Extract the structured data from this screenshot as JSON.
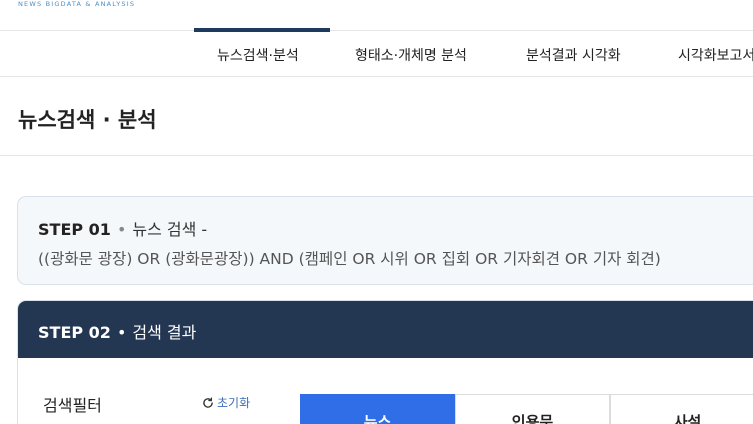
{
  "header": {
    "logo_subtitle": "NEWS BIGDATA & ANALYSIS"
  },
  "nav": {
    "items": [
      {
        "label": "뉴스검색·분석"
      },
      {
        "label": "형태소·개체명 분석"
      },
      {
        "label": "분석결과 시각화"
      },
      {
        "label": "시각화보고서"
      }
    ],
    "active_index": 0
  },
  "page": {
    "title": "뉴스검색 · 분석"
  },
  "step1": {
    "label": "STEP 01",
    "title": "뉴스 검색 -",
    "query": "((광화문 광장) OR (광화문광장)) AND (캠페인 OR 시위 OR 집회 OR 기자회견 OR 기자 회견)"
  },
  "step2": {
    "label": "STEP 02",
    "title": "검색 결과",
    "filter_label": "검색필터",
    "reset_label": "초기화",
    "tabs": [
      {
        "label": "뉴스",
        "active": true
      },
      {
        "label": "인용문",
        "active": false
      },
      {
        "label": "사설",
        "active": false
      }
    ]
  },
  "colors": {
    "navy": "#233652",
    "accent_blue": "#2f6ee6",
    "link_blue": "#3b6fb6"
  }
}
